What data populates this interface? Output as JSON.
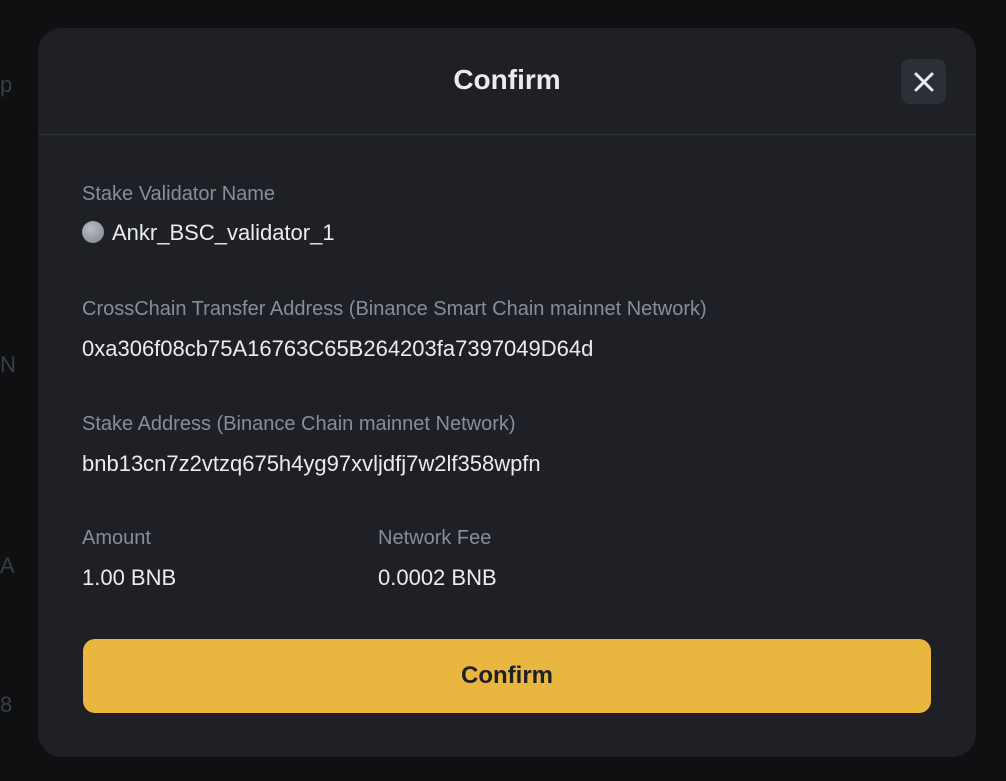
{
  "modal": {
    "title": "Confirm",
    "close_icon": "close-icon"
  },
  "validator": {
    "label": "Stake Validator Name",
    "value": "Ankr_BSC_validator_1",
    "icon": "validator-avatar-icon"
  },
  "crosschain": {
    "label": "CrossChain Transfer Address (Binance Smart Chain mainnet Network)",
    "value": "0xa306f08cb75A16763C65B264203fa7397049D64d"
  },
  "stake_address": {
    "label": "Stake Address (Binance Chain mainnet Network)",
    "value": "bnb13cn7z2vtzq675h4yg97xvljdfj7w2lf358wpfn"
  },
  "amount": {
    "label": "Amount",
    "value": "1.00 BNB"
  },
  "network_fee": {
    "label": "Network Fee",
    "value": "0.0002 BNB"
  },
  "confirm_button": {
    "label": "Confirm",
    "color": "#e9b73f"
  },
  "colors": {
    "modal_bg": "#1e2026",
    "label": "#848e9c",
    "text": "#eaecef"
  }
}
